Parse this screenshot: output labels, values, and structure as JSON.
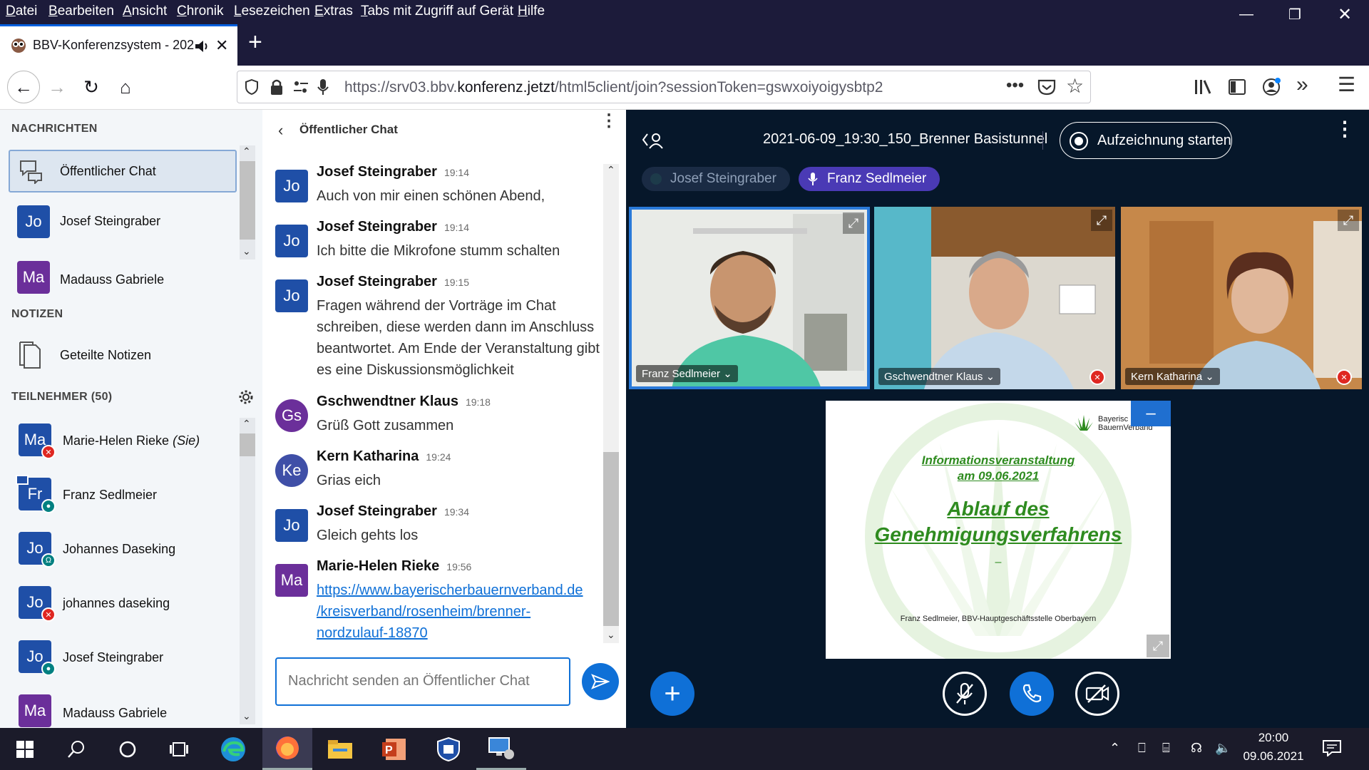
{
  "menu": {
    "items": [
      {
        "u": "D",
        "rest": "atei"
      },
      {
        "u": "B",
        "rest": "earbeiten"
      },
      {
        "u": "A",
        "rest": "nsicht"
      },
      {
        "u": "C",
        "rest": "hronik"
      },
      {
        "u": "L",
        "rest": "esezeichen"
      },
      {
        "u": "E",
        "rest": "xtras"
      },
      {
        "u": "T",
        "rest": "abs mit Zugriff auf Gerät"
      },
      {
        "u": "H",
        "rest": "ilfe"
      }
    ]
  },
  "tab": {
    "title": "BBV-Konferenzsystem - 202"
  },
  "url": {
    "prefix": "https://srv03.bbv.",
    "domain": "konferenz.jetzt",
    "path": "/html5client/join?sessionToken=gswxoiyoigysbtp2"
  },
  "sidebar": {
    "messages_header": "NACHRICHTEN",
    "public_chat": "Öffentlicher Chat",
    "chats": [
      {
        "initials": "Jo",
        "name": "Josef Steingraber"
      },
      {
        "initials": "Ma",
        "name": "Madauss Gabriele"
      }
    ],
    "notes_header": "NOTIZEN",
    "shared_notes": "Geteilte Notizen",
    "participants_header": "TEILNEHMER (50)",
    "participants": [
      {
        "initials": "Ma",
        "name": "Marie-Helen Rieke",
        "suffix": "(Sie)",
        "status": "muted"
      },
      {
        "initials": "Fr",
        "name": "Franz Sedlmeier",
        "suffix": "",
        "status": "mic"
      },
      {
        "initials": "Jo",
        "name": "Johannes Daseking",
        "suffix": "",
        "status": "listen"
      },
      {
        "initials": "Jo",
        "name": "johannes daseking",
        "suffix": "",
        "status": "muted"
      },
      {
        "initials": "Jo",
        "name": "Josef Steingraber",
        "suffix": "",
        "status": "mic"
      },
      {
        "initials": "Ma",
        "name": "Madauss Gabriele",
        "suffix": "",
        "status": "muted"
      }
    ]
  },
  "chat": {
    "title": "Öffentlicher Chat",
    "messages": [
      {
        "initials": "Jo",
        "author": "Josef Steingraber",
        "time": "19:14",
        "text": "Auch von mir einen schönen Abend,"
      },
      {
        "initials": "Jo",
        "author": "Josef Steingraber",
        "time": "19:14",
        "text": "Ich bitte die Mikrofone stumm schalten"
      },
      {
        "initials": "Jo",
        "author": "Josef Steingraber",
        "time": "19:15",
        "text": "Fragen während der Vorträge im Chat schreiben, diese werden dann im Anschluss beantwortet. Am Ende der Veranstaltung gibt es eine Diskussionsmöglichkeit"
      },
      {
        "initials": "Gs",
        "author": "Gschwendtner Klaus",
        "time": "19:18",
        "text": "Grüß Gott zusammen"
      },
      {
        "initials": "Ke",
        "author": "Kern Katharina",
        "time": "19:24",
        "text": "Grias eich"
      },
      {
        "initials": "Jo",
        "author": "Josef Steingraber",
        "time": "19:34",
        "text": "Gleich gehts los"
      },
      {
        "initials": "Ma",
        "author": "Marie-Helen Rieke",
        "time": "19:56",
        "link": "https://www.bayerischerbauernverband.de/kreisverband/rosenheim/brenner-nordzulauf-18870",
        "link_lines": [
          "https://www.bayerischerbauernverband.de",
          "/kreisverband/rosenheim/brenner-",
          "nordzulauf-18870"
        ]
      }
    ],
    "input_placeholder": "Nachricht senden an Öffentlicher Chat"
  },
  "main": {
    "meeting_title": "2021-06-09_19:30_150_Brenner Basistunnel",
    "record_label": "Aufzeichnung starten",
    "talkers": [
      "Josef Steingraber",
      "Franz Sedlmeier"
    ],
    "videos": [
      {
        "name": "Franz Sedlmeier"
      },
      {
        "name": "Gschwendtner Klaus"
      },
      {
        "name": "Kern Katharina"
      }
    ],
    "presentation": {
      "logo_line1": "Bayerisc",
      "logo_line2": "BauernVerband",
      "subtitle1": "Informationsveranstaltung",
      "subtitle2": "am 09.06.2021",
      "title1": "Ablauf des",
      "title2": "Genehmigungsverfahrens",
      "dash": "–",
      "footer": "Franz Sedlmeier, BBV-Hauptgeschäftsstelle Oberbayern"
    }
  },
  "taskbar": {
    "time": "20:00",
    "date": "09.06.2021"
  },
  "colors": {
    "accent": "#0f70d7",
    "dark_bg": "#06172a",
    "firefox_bar": "#1c1b3a",
    "slide_green": "#2e8b1f"
  }
}
